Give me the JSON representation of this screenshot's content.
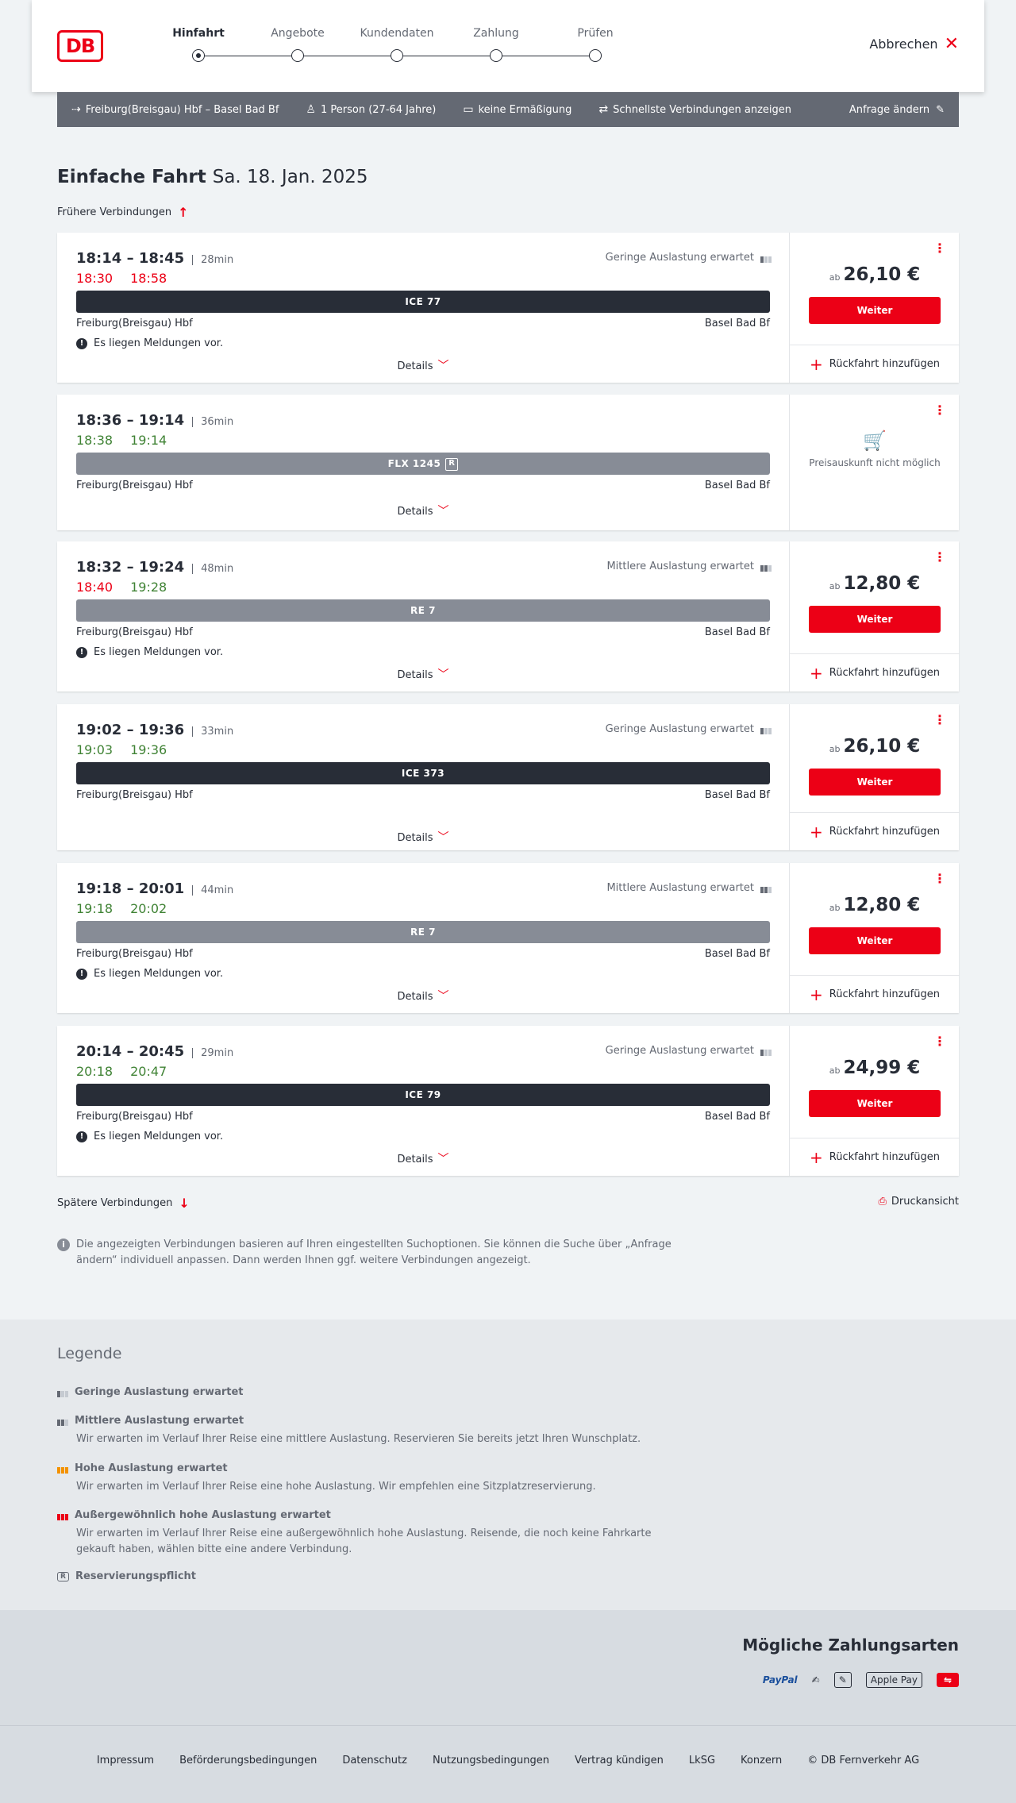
{
  "header": {
    "logo": "DB",
    "steps": [
      "Hinfahrt",
      "Angebote",
      "Kundendaten",
      "Zahlung",
      "Prüfen"
    ],
    "active_step": 0,
    "cancel_label": "Abbrechen"
  },
  "search": {
    "route": "Freiburg(Breisgau) Hbf – Basel Bad Bf",
    "passengers": "1 Person (27-64 Jahre)",
    "discount": "keine Ermäßigung",
    "option": "Schnellste Verbindungen anzeigen",
    "edit_label": "Anfrage ändern"
  },
  "page": {
    "title": "Einfache Fahrt",
    "date": "Sa. 18. Jan. 2025",
    "earlier": "Frühere Verbindungen",
    "later": "Spätere Verbindungen",
    "print": "Druckansicht",
    "details_label": "Details",
    "weiter_label": "Weiter",
    "return_label": "Rückfahrt hinzufügen",
    "ab": "ab",
    "no_price": "Preisauskunft nicht möglich",
    "info": "Die angezeigten Verbindungen basieren auf Ihren eingestellten Suchoptionen. Sie können die Suche über „Anfrage ändern“ individuell anpassen. Dann werden Ihnen ggf. weitere Verbindungen angezeigt."
  },
  "connections": [
    {
      "times": "18:14 – 18:45",
      "duration": "28min",
      "dep_real": "18:30",
      "arr_real": "18:58",
      "dep_status": "delayed",
      "arr_status": "delayed",
      "occupancy": "Geringe Auslastung erwartet",
      "occ_level": 1,
      "train": "ICE 77",
      "train_style": "dark",
      "reservation": false,
      "from": "Freiburg(Breisgau) Hbf",
      "to": "Basel Bad Bf",
      "message": "Es liegen Meldungen vor.",
      "price": "26,10 €"
    },
    {
      "times": "18:36 – 19:14",
      "duration": "36min",
      "dep_real": "18:38",
      "arr_real": "19:14",
      "dep_status": "ontime",
      "arr_status": "ontime",
      "occupancy": "",
      "occ_level": 0,
      "train": "FLX 1245",
      "train_style": "gray",
      "reservation": true,
      "from": "Freiburg(Breisgau) Hbf",
      "to": "Basel Bad Bf",
      "message": "",
      "price": ""
    },
    {
      "times": "18:32 – 19:24",
      "duration": "48min",
      "dep_real": "18:40",
      "arr_real": "19:28",
      "dep_status": "delayed",
      "arr_status": "ontime",
      "occupancy": "Mittlere Auslastung erwartet",
      "occ_level": 2,
      "train": "RE 7",
      "train_style": "gray",
      "reservation": false,
      "from": "Freiburg(Breisgau) Hbf",
      "to": "Basel Bad Bf",
      "message": "Es liegen Meldungen vor.",
      "price": "12,80 €"
    },
    {
      "times": "19:02 – 19:36",
      "duration": "33min",
      "dep_real": "19:03",
      "arr_real": "19:36",
      "dep_status": "ontime",
      "arr_status": "ontime",
      "occupancy": "Geringe Auslastung erwartet",
      "occ_level": 1,
      "train": "ICE 373",
      "train_style": "dark",
      "reservation": false,
      "from": "Freiburg(Breisgau) Hbf",
      "to": "Basel Bad Bf",
      "message": "",
      "price": "26,10 €"
    },
    {
      "times": "19:18 – 20:01",
      "duration": "44min",
      "dep_real": "19:18",
      "arr_real": "20:02",
      "dep_status": "ontime",
      "arr_status": "ontime",
      "occupancy": "Mittlere Auslastung erwartet",
      "occ_level": 2,
      "train": "RE 7",
      "train_style": "gray",
      "reservation": false,
      "from": "Freiburg(Breisgau) Hbf",
      "to": "Basel Bad Bf",
      "message": "Es liegen Meldungen vor.",
      "price": "12,80 €"
    },
    {
      "times": "20:14 – 20:45",
      "duration": "29min",
      "dep_real": "20:18",
      "arr_real": "20:47",
      "dep_status": "ontime",
      "arr_status": "ontime",
      "occupancy": "Geringe Auslastung erwartet",
      "occ_level": 1,
      "train": "ICE 79",
      "train_style": "dark",
      "reservation": false,
      "from": "Freiburg(Breisgau) Hbf",
      "to": "Basel Bad Bf",
      "message": "Es liegen Meldungen vor.",
      "price": "24,99 €"
    }
  ],
  "legend": {
    "title": "Legende",
    "items": [
      {
        "title": "Geringe Auslastung erwartet",
        "desc": "",
        "icon": "occupancy-low-icon",
        "color": "#646973"
      },
      {
        "title": "Mittlere Auslastung erwartet",
        "desc": "Wir erwarten im Verlauf Ihrer Reise eine mittlere Auslastung. Reservieren Sie bereits jetzt Ihren Wunschplatz.",
        "icon": "occupancy-medium-icon",
        "color": "#646973"
      },
      {
        "title": "Hohe Auslastung erwartet",
        "desc": "Wir erwarten im Verlauf Ihrer Reise eine hohe Auslastung. Wir empfehlen eine Sitzplatzreservierung.",
        "icon": "occupancy-high-icon",
        "color": "#f39200"
      },
      {
        "title": "Außergewöhnlich hohe Auslastung erwartet",
        "desc": "Wir erwarten im Verlauf Ihrer Reise eine außergewöhnlich hohe Auslastung. Reisende, die noch keine Fahrkarte gekauft haben, wählen bitte eine andere Verbindung.",
        "icon": "occupancy-extreme-icon",
        "color": "#ec0016"
      },
      {
        "title": "Reservierungspflicht",
        "desc": "",
        "icon": "reservation-icon",
        "color": "#646973"
      }
    ]
  },
  "payment": {
    "title": "Mögliche Zahlungsarten",
    "methods": [
      "PayPal",
      "Lastschrift",
      "Rechnung",
      "Apple Pay",
      "DB"
    ]
  },
  "footer": {
    "links": [
      "Impressum",
      "Beförderungsbedingungen",
      "Datenschutz",
      "Nutzungsbedingungen",
      "Vertrag kündigen",
      "LkSG",
      "Konzern",
      "© DB Fernverkehr AG"
    ]
  },
  "colors": {
    "accent": "#ec0016",
    "ontime": "#408335",
    "dark": "#282d37",
    "gray": "#878c96"
  }
}
